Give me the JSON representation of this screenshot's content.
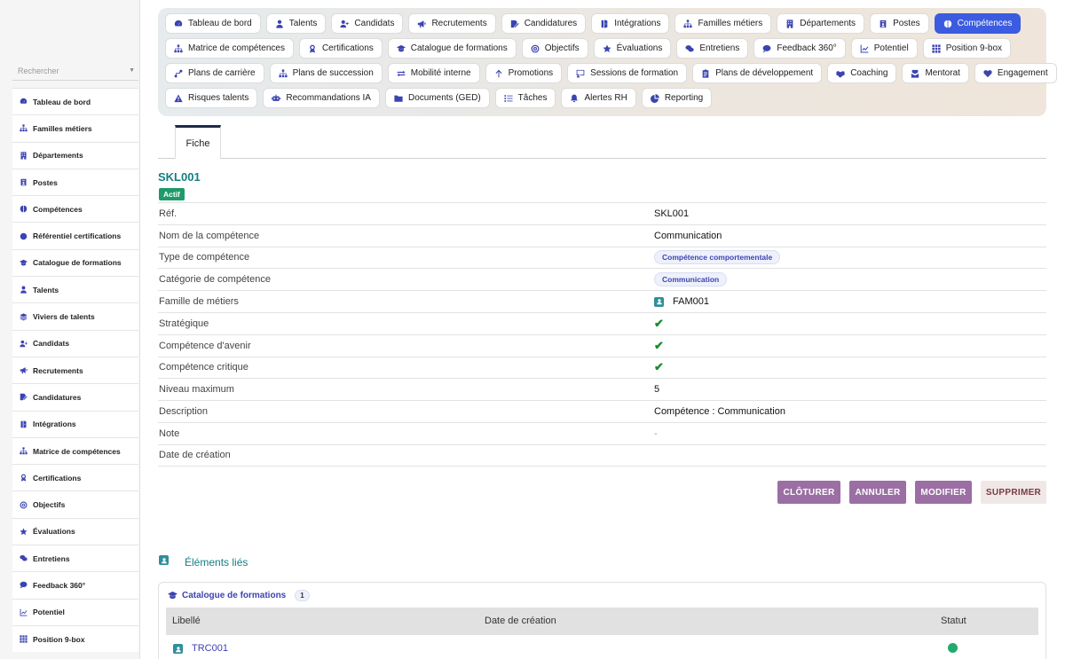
{
  "sidebar": {
    "search_placeholder": "Rechercher",
    "items": [
      {
        "label": "Tableau de bord",
        "icon": "dashboard-icon"
      },
      {
        "label": "Familles métiers",
        "icon": "sitemap-icon"
      },
      {
        "label": "Départements",
        "icon": "building-icon"
      },
      {
        "label": "Postes",
        "icon": "badge-icon"
      },
      {
        "label": "Compétences",
        "icon": "brain-icon"
      },
      {
        "label": "Référentiel certifications",
        "icon": "certificate-icon"
      },
      {
        "label": "Catalogue de formations",
        "icon": "graduation-cap-icon"
      },
      {
        "label": "Talents",
        "icon": "user-icon"
      },
      {
        "label": "Viviers de talents",
        "icon": "layers-icon"
      },
      {
        "label": "Candidats",
        "icon": "user-plus-icon"
      },
      {
        "label": "Recrutements",
        "icon": "megaphone-icon"
      },
      {
        "label": "Candidatures",
        "icon": "file-signature-icon"
      },
      {
        "label": "Intégrations",
        "icon": "door-icon"
      },
      {
        "label": "Matrice de compétences",
        "icon": "sitemap-icon"
      },
      {
        "label": "Certifications",
        "icon": "award-icon"
      },
      {
        "label": "Objectifs",
        "icon": "target-icon"
      },
      {
        "label": "Évaluations",
        "icon": "star-icon"
      },
      {
        "label": "Entretiens",
        "icon": "comments-icon"
      },
      {
        "label": "Feedback 360°",
        "icon": "comment-icon"
      },
      {
        "label": "Potentiel",
        "icon": "chart-line-icon"
      },
      {
        "label": "Position 9-box",
        "icon": "grid-icon"
      }
    ]
  },
  "topbar": {
    "rows": [
      [
        {
          "label": "Tableau de bord",
          "icon": "dashboard-icon"
        },
        {
          "label": "Talents",
          "icon": "user-icon"
        },
        {
          "label": "Candidats",
          "icon": "user-plus-icon"
        },
        {
          "label": "Recrutements",
          "icon": "megaphone-icon"
        },
        {
          "label": "Candidatures",
          "icon": "file-signature-icon"
        },
        {
          "label": "Intégrations",
          "icon": "door-icon"
        },
        {
          "label": "Familles métiers",
          "icon": "sitemap-icon"
        },
        {
          "label": "Départements",
          "icon": "building-icon"
        },
        {
          "label": "Postes",
          "icon": "badge-icon"
        },
        {
          "label": "Compétences",
          "icon": "brain-icon",
          "active": true
        }
      ],
      [
        {
          "label": "Matrice de compétences",
          "icon": "sitemap-icon"
        },
        {
          "label": "Certifications",
          "icon": "award-icon"
        },
        {
          "label": "Catalogue de formations",
          "icon": "graduation-cap-icon"
        },
        {
          "label": "Objectifs",
          "icon": "target-icon"
        },
        {
          "label": "Évaluations",
          "icon": "star-icon"
        },
        {
          "label": "Entretiens",
          "icon": "comments-icon"
        },
        {
          "label": "Feedback 360°",
          "icon": "comment-icon"
        },
        {
          "label": "Potentiel",
          "icon": "chart-line-icon"
        },
        {
          "label": "Position 9-box",
          "icon": "grid-icon"
        }
      ],
      [
        {
          "label": "Plans de carrière",
          "icon": "route-icon"
        },
        {
          "label": "Plans de succession",
          "icon": "sitemap-icon"
        },
        {
          "label": "Mobilité interne",
          "icon": "exchange-icon"
        },
        {
          "label": "Promotions",
          "icon": "arrow-up-icon"
        },
        {
          "label": "Sessions de formation",
          "icon": "chalkboard-icon"
        },
        {
          "label": "Plans de développement",
          "icon": "clipboard-icon"
        },
        {
          "label": "Coaching",
          "icon": "handshake-icon"
        },
        {
          "label": "Mentorat",
          "icon": "mentor-icon"
        },
        {
          "label": "Engagement",
          "icon": "heart-icon"
        }
      ],
      [
        {
          "label": "Risques talents",
          "icon": "warning-icon"
        },
        {
          "label": "Recommandations IA",
          "icon": "robot-icon"
        },
        {
          "label": "Documents (GED)",
          "icon": "folder-icon"
        },
        {
          "label": "Tâches",
          "icon": "tasks-icon"
        },
        {
          "label": "Alertes RH",
          "icon": "bell-icon"
        },
        {
          "label": "Reporting",
          "icon": "chart-pie-icon"
        }
      ]
    ]
  },
  "subtab": {
    "label": "Fiche"
  },
  "record": {
    "code": "SKL001",
    "status": "Actif",
    "fields": [
      {
        "label": "Réf.",
        "type": "text",
        "value": "SKL001"
      },
      {
        "label": "Nom de la compétence",
        "type": "text",
        "value": "Communication"
      },
      {
        "label": "Type de compétence",
        "type": "chip",
        "value": "Compétence comportementale"
      },
      {
        "label": "Catégorie de compétence",
        "type": "chip",
        "value": "Communication"
      },
      {
        "label": "Famille de métiers",
        "type": "link",
        "value": "FAM001"
      },
      {
        "label": "Stratégique",
        "type": "check",
        "value": "✔"
      },
      {
        "label": "Compétence d'avenir",
        "type": "check",
        "value": "✔"
      },
      {
        "label": "Compétence critique",
        "type": "check",
        "value": "✔"
      },
      {
        "label": "Niveau maximum",
        "type": "text",
        "value": "5"
      },
      {
        "label": "Description",
        "type": "text",
        "value": "Compétence : Communication"
      },
      {
        "label": "Note",
        "type": "dash",
        "value": "-"
      },
      {
        "label": "Date de création",
        "type": "text",
        "value": ""
      }
    ]
  },
  "actions": {
    "close": "CLÔTURER",
    "cancel": "ANNULER",
    "edit": "MODIFIER",
    "delete": "SUPPRIMER"
  },
  "linked": {
    "title": "Éléments liés",
    "card_title": "Catalogue de formations",
    "count": "1",
    "columns": [
      "Libellé",
      "Date de création",
      "Statut"
    ],
    "rows": [
      {
        "label": "TRC001",
        "date": "",
        "status_color": "#22a96c"
      }
    ]
  },
  "colors": {
    "accent": "#3b5ce0",
    "teal": "#137f82",
    "status_active": "#1f9a6a",
    "button_purple": "#9b6fa3"
  }
}
